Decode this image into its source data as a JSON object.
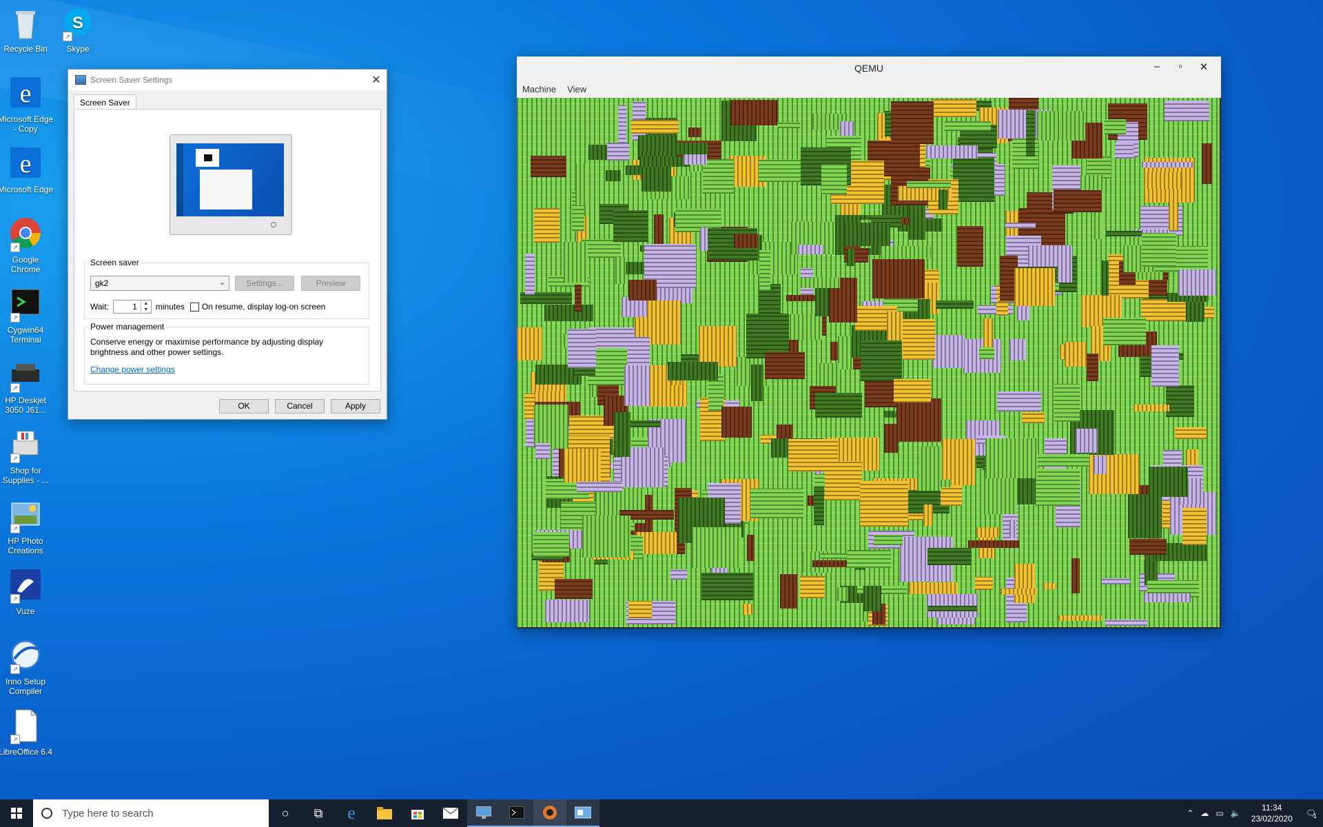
{
  "desktop": {
    "icons": [
      {
        "label": "Recycle Bin",
        "icon": "recycle-bin-icon"
      },
      {
        "label": "Skype",
        "icon": "skype-icon"
      },
      {
        "label": "Microsoft Edge - Copy",
        "icon": "edge-icon"
      },
      {
        "label": "Microsoft Edge",
        "icon": "edge-icon"
      },
      {
        "label": "Google Chrome",
        "icon": "chrome-icon"
      },
      {
        "label": "Cygwin64 Terminal",
        "icon": "terminal-icon"
      },
      {
        "label": "HP Deskjet 3050 J61...",
        "icon": "printer-icon"
      },
      {
        "label": "Shop for Supplies - ...",
        "icon": "shop-icon"
      },
      {
        "label": "HP Photo Creations",
        "icon": "photo-icon"
      },
      {
        "label": "Vuze",
        "icon": "vuze-icon"
      },
      {
        "label": "Inno Setup Compiler",
        "icon": "inno-setup-icon"
      },
      {
        "label": "LibreOffice 6.4",
        "icon": "libreoffice-icon"
      }
    ]
  },
  "dialog": {
    "title": "Screen Saver Settings",
    "tab": "Screen Saver",
    "screen_saver_group": "Screen saver",
    "selected_saver": "gk2",
    "settings_label": "Settings...",
    "preview_label": "Preview",
    "wait_label": "Wait:",
    "wait_value": "1",
    "minutes_label": "minutes",
    "resume_label": "On resume, display log-on screen",
    "power_group": "Power management",
    "power_text": "Conserve energy or maximise performance by adjusting display brightness and other power settings.",
    "power_link": "Change power settings",
    "ok_label": "OK",
    "cancel_label": "Cancel",
    "apply_label": "Apply"
  },
  "qemu": {
    "title": "QEMU",
    "menu": [
      "Machine",
      "View"
    ]
  },
  "taskbar": {
    "search_placeholder": "Type here to search",
    "time": "11:34",
    "date": "23/02/2020",
    "notification_count": "1"
  },
  "colors": {
    "maze_green": "#7fd650",
    "maze_dark_green": "#3f7a22",
    "maze_brown": "#7a3a1c",
    "maze_yellow": "#f2c233",
    "maze_lavender": "#c7b4e8"
  }
}
